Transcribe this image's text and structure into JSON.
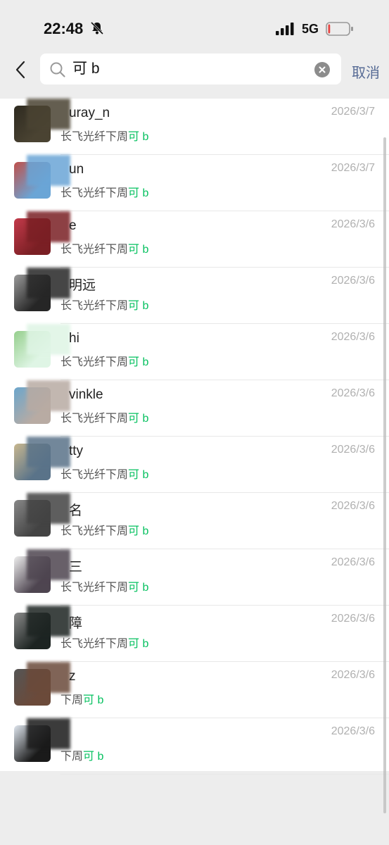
{
  "status_bar": {
    "time": "22:48",
    "network": "5G",
    "battery_level": 0.1,
    "battery_color": "#e64340"
  },
  "search": {
    "query": "可 b",
    "cancel_label": "取消"
  },
  "colors": {
    "highlight": "#07c160",
    "cancel": "#576b95"
  },
  "results": [
    {
      "name": "uray_n",
      "date": "2026/3/7",
      "prefix": "长飞光纤下周",
      "highlight": "可 b"
    },
    {
      "name": "un",
      "date": "2026/3/7",
      "prefix": "长飞光纤下周",
      "highlight": "可 b"
    },
    {
      "name": "e",
      "date": "2026/3/6",
      "prefix": "长飞光纤下周",
      "highlight": "可 b"
    },
    {
      "name": "明远",
      "date": "2026/3/6",
      "prefix": "长飞光纤下周",
      "highlight": "可 b"
    },
    {
      "name": "hi",
      "date": "2026/3/6",
      "prefix": "长飞光纤下周",
      "highlight": "可 b"
    },
    {
      "name": "vinkle",
      "date": "2026/3/6",
      "prefix": "长飞光纤下周",
      "highlight": "可 b"
    },
    {
      "name": "tty",
      "date": "2026/3/6",
      "prefix": "长飞光纤下周",
      "highlight": "可 b"
    },
    {
      "name": "名",
      "date": "2026/3/6",
      "prefix": "长飞光纤下周",
      "highlight": "可 b"
    },
    {
      "name": "三",
      "date": "2026/3/6",
      "prefix": "长飞光纤下周",
      "highlight": "可 b"
    },
    {
      "name": "障",
      "date": "2026/3/6",
      "prefix": "长飞光纤下周",
      "highlight": "可 b"
    },
    {
      "name": "z",
      "date": "2026/3/6",
      "prefix": "下周",
      "highlight": "可 b"
    },
    {
      "name": "",
      "date": "2026/3/6",
      "prefix": "下周",
      "highlight": "可 b"
    }
  ]
}
